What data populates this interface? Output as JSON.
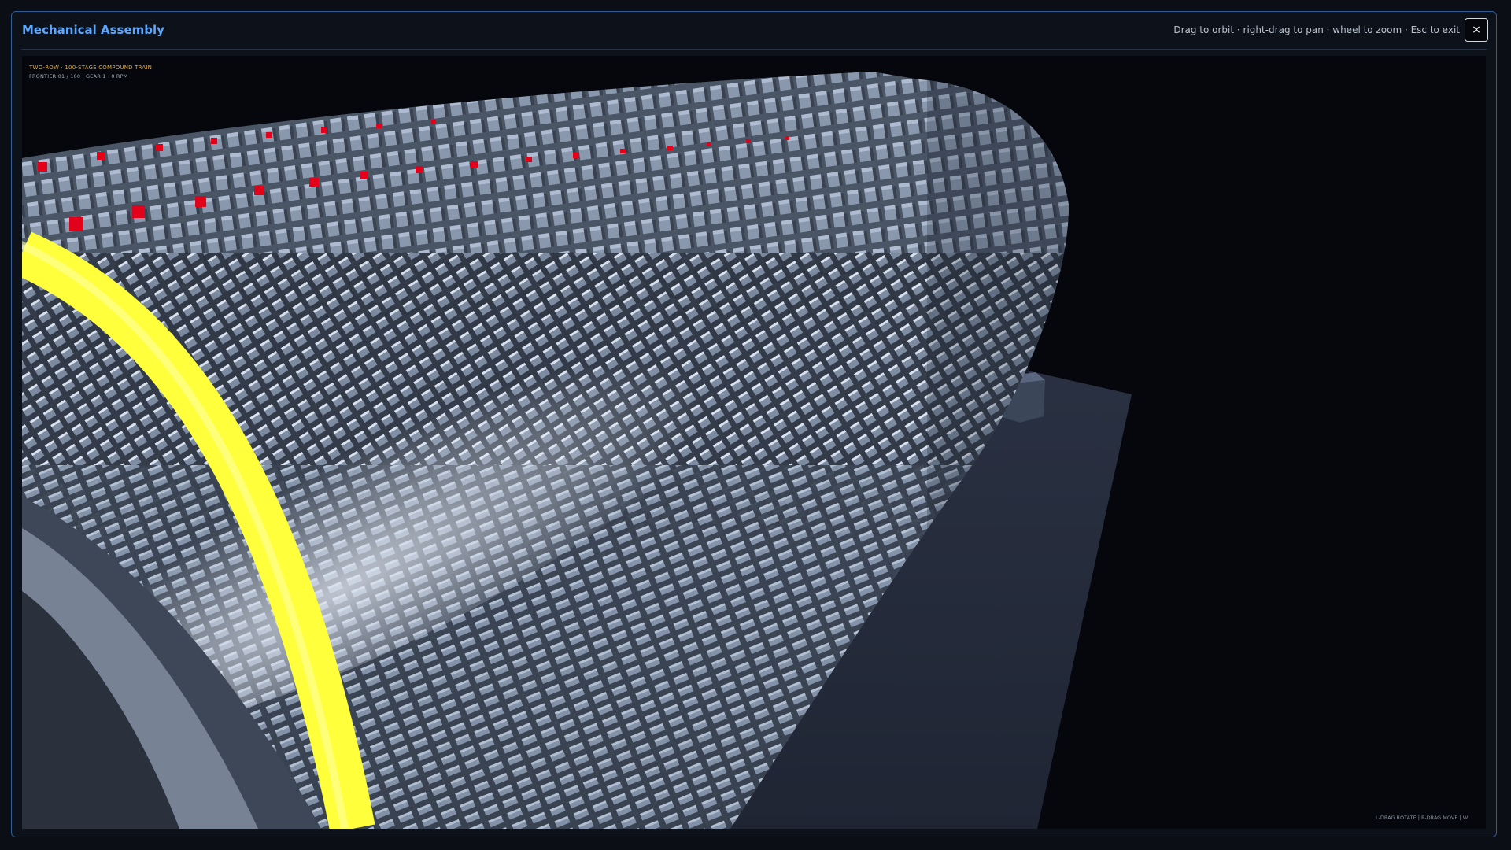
{
  "window": {
    "title": "Mechanical Assembly",
    "hint": "Drag to orbit · right-drag to pan · wheel to zoom · Esc to exit",
    "close_label": "×"
  },
  "viewport": {
    "overlay_title": "TWO-ROW · 100-STAGE COMPOUND TRAIN",
    "overlay_sub": "FRONTIER 01 / 100 · GEAR 1 · 0 RPM",
    "controls_hint": "L-DRAG ROTATE  |  R-DRAG MOVE  |  W"
  },
  "colors": {
    "accent": "#5aa7ff",
    "overlay_title": "#e7a93a",
    "tooth": "#7f8ea3",
    "highlight_ring": "#ffff3c",
    "active_tooth": "#e3001b",
    "floor": "#2a3040"
  }
}
